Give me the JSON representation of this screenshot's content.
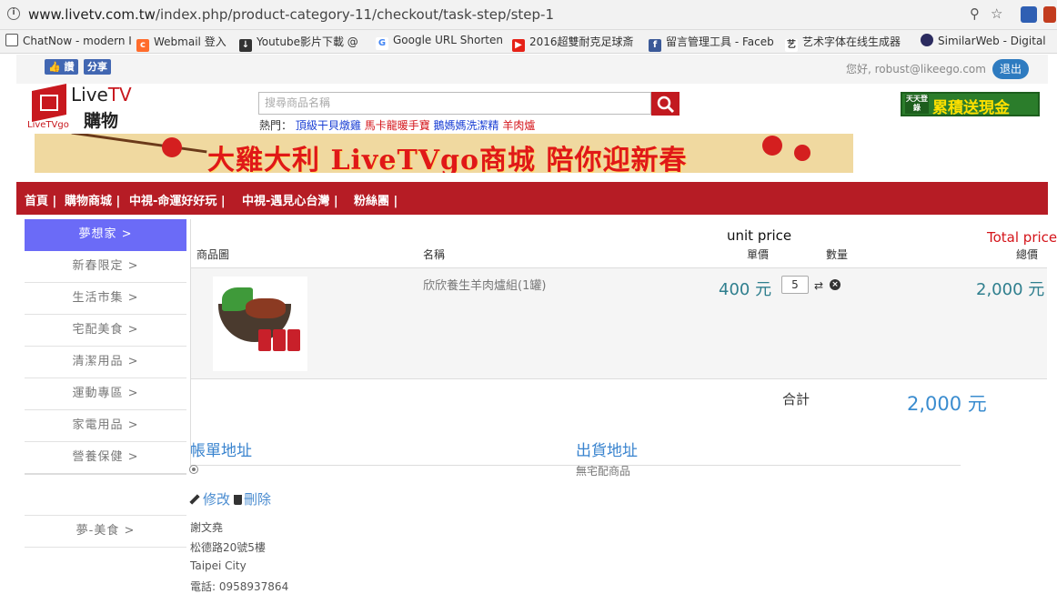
{
  "browser": {
    "url_host": "www.livetv.com.tw",
    "url_path": "/index.php/product-category-11/checkout/task-step/step-1",
    "bookmarks": [
      {
        "label": "ChatNow - modern I",
        "icon": "doc-icon",
        "color": "#555555"
      },
      {
        "label": "Webmail 登入",
        "icon": "cpanel-icon",
        "color": "#ff6c2c"
      },
      {
        "label": "Youtube影片下載 @",
        "icon": "download-icon",
        "color": "#333333"
      },
      {
        "label": "Google URL Shorten",
        "icon": "google-icon",
        "color": "#4285f4"
      },
      {
        "label": "2016超雙耐克足球斎",
        "icon": "youtube-icon",
        "color": "#e62117"
      },
      {
        "label": "留言管理工具 - Faceb",
        "icon": "facebook-icon",
        "color": "#3b5998"
      },
      {
        "label": "艺术字体在线生成器 ",
        "icon": "art-icon",
        "color": "#333333"
      },
      {
        "label": "SimilarWeb - Digital",
        "icon": "similarweb-icon",
        "color": "#2b2b5f"
      }
    ]
  },
  "topbar": {
    "like_label": "讚",
    "share_label": "分享",
    "greeting": "您好, robust@likeego.com",
    "logout_label": "退出"
  },
  "header": {
    "logo_tv_prefix": "Live",
    "logo_tv_suffix": "TV",
    "logo_shop": "購物",
    "logo_sub": "LiveTVgo",
    "search_placeholder": "搜尋商品名稱",
    "hot_label": "熱門：",
    "hot_keywords": [
      "頂級干貝燉雞",
      "馬卡龍暖手寶",
      "鵝媽媽洗潔精",
      "羊肉爐"
    ],
    "promo_small": "天天登錄",
    "promo_big": "累積送現金"
  },
  "banner": {
    "text": "大雞大利 LiveTVgo商城 陪你迎新春"
  },
  "nav": {
    "items": [
      "首頁 |",
      "購物商城 |",
      "中視-命運好好玩 |",
      "中視-遇見心台灣 |",
      "粉絲團 |"
    ]
  },
  "sidebar": {
    "items": [
      "夢想家 >",
      "新春限定 >",
      "生活市集 >",
      "宅配美食 >",
      "清潔用品 >",
      "運動專區 >",
      "家電用品 >",
      "營養保健 >"
    ],
    "extra": "夢-美食 >"
  },
  "cart": {
    "col_image": "商品圖",
    "col_name": "名稱",
    "col_unit": "單價",
    "col_qty": "數量",
    "col_total": "總價",
    "annot_unit": "unit price",
    "annot_total": "Total price",
    "item": {
      "name": "欣欣養生羊肉爐組(1罐)",
      "unit_price": "400 元",
      "qty": "5",
      "total": "2,000 元"
    },
    "sum_label": "合計",
    "sum_value": "2,000 元"
  },
  "address": {
    "billing_title": "帳單地址",
    "shipping_title": "出貨地址",
    "no_ship_text": "無宅配商品",
    "edit_label": "修改",
    "delete_label": "刪除",
    "name": "謝文堯",
    "street": "松德路20號5樓",
    "city": "Taipei City",
    "phone": "電話: 0958937864"
  }
}
